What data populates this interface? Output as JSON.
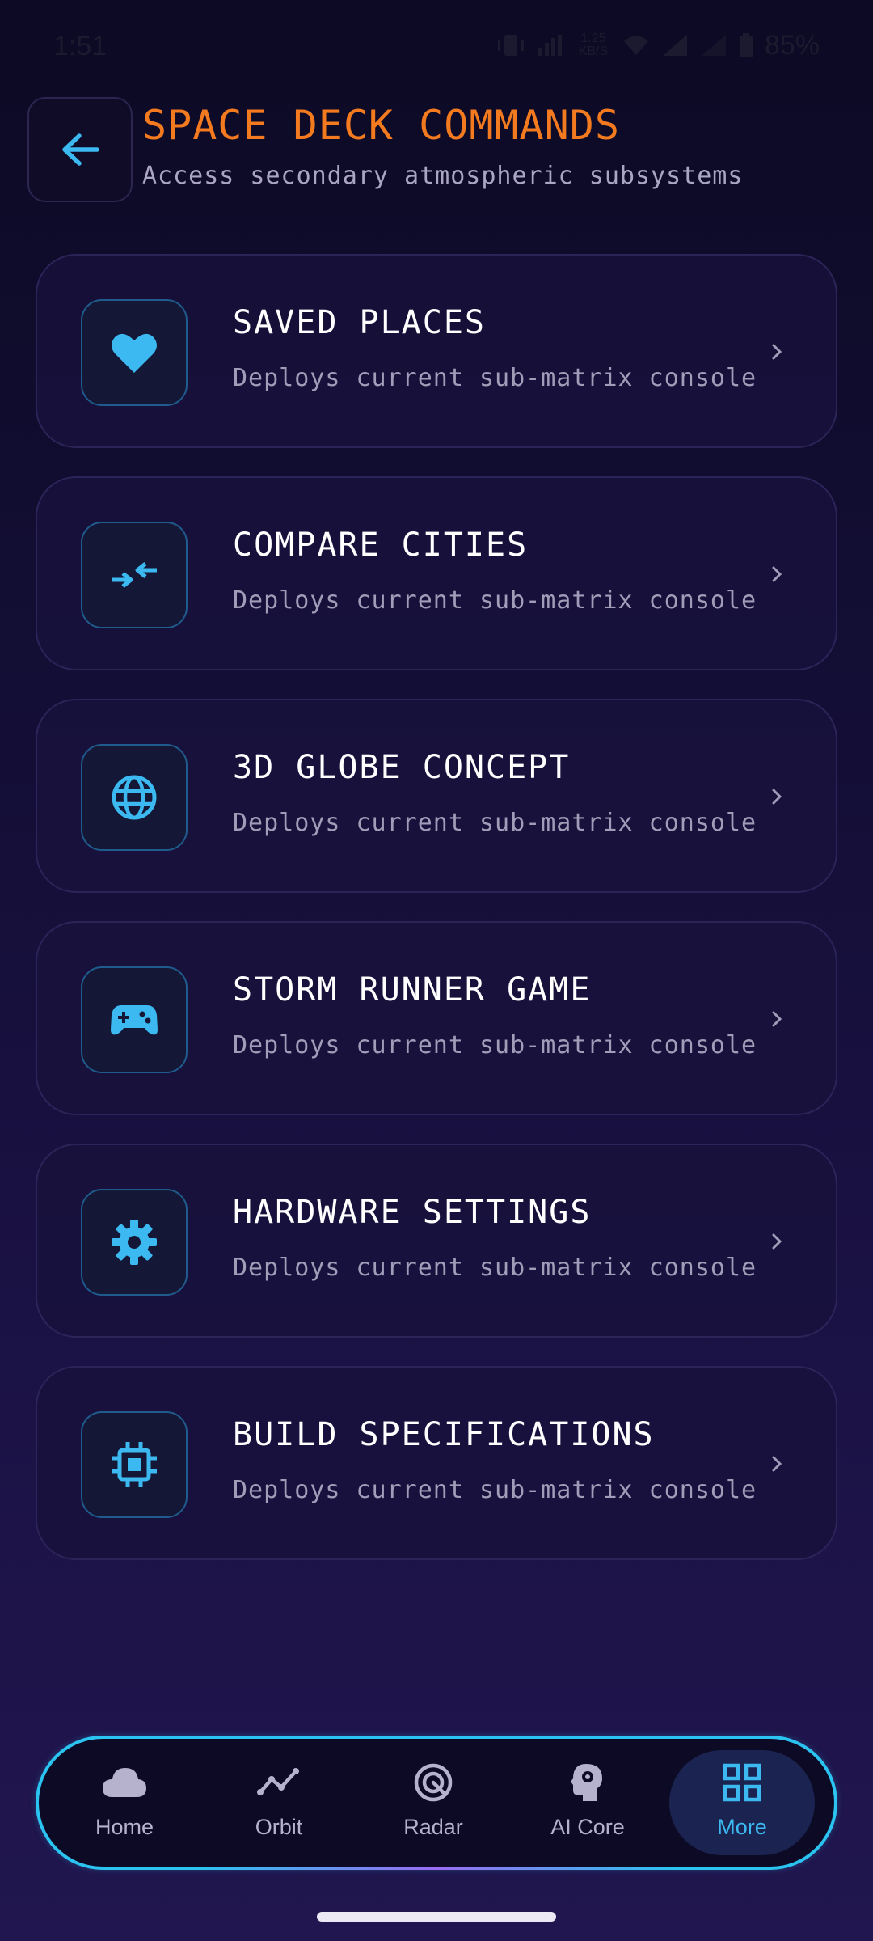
{
  "status_bar": {
    "time": "1:51",
    "battery": "85%",
    "speed": "1.25\nKB/S"
  },
  "header": {
    "title": "SPACE DECK COMMANDS",
    "subtitle": "Access secondary atmospheric subsystems",
    "back_icon": "arrow-left-icon"
  },
  "menu": [
    {
      "title": "SAVED PLACES",
      "description": "Deploys current sub-matrix console",
      "icon": "heart-icon"
    },
    {
      "title": "COMPARE CITIES",
      "description": "Deploys current sub-matrix console",
      "icon": "compare-arrows-icon"
    },
    {
      "title": "3D GLOBE CONCEPT",
      "description": "Deploys current sub-matrix console",
      "icon": "globe-icon"
    },
    {
      "title": "STORM RUNNER GAME",
      "description": "Deploys current sub-matrix console",
      "icon": "gamepad-icon"
    },
    {
      "title": "HARDWARE SETTINGS",
      "description": "Deploys current sub-matrix console",
      "icon": "gear-icon"
    },
    {
      "title": "BUILD SPECIFICATIONS",
      "description": "Deploys current sub-matrix console",
      "icon": "chip-icon"
    }
  ],
  "bottom_nav": [
    {
      "label": "Home",
      "icon": "cloud-icon",
      "active": false
    },
    {
      "label": "Orbit",
      "icon": "trend-line-icon",
      "active": false
    },
    {
      "label": "Radar",
      "icon": "radar-icon",
      "active": false
    },
    {
      "label": "AI Core",
      "icon": "brain-head-icon",
      "active": false
    },
    {
      "label": "More",
      "icon": "grid-icon",
      "active": true
    }
  ],
  "colors": {
    "accent_orange": "#f47a1f",
    "accent_cyan": "#3bb9f0",
    "card_border": "#2c2458",
    "background": "#130e35"
  }
}
